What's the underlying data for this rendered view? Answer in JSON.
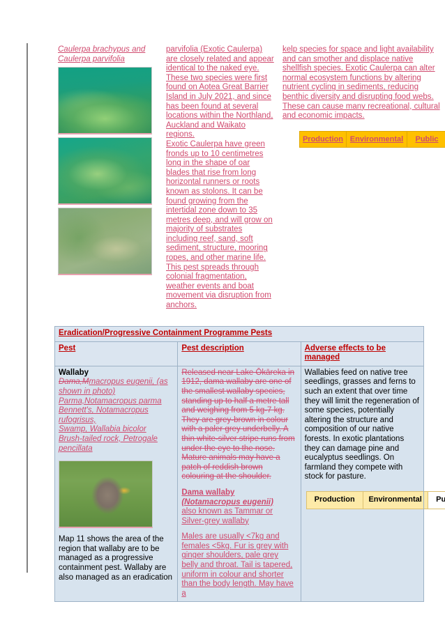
{
  "document": {
    "change_bar": true
  },
  "caulerpa_section": {
    "species_heading": "Caulerpa brachypus and Caulerpa parvifolia",
    "photos": [
      {
        "name": "caulerpa-photo-1",
        "alt": "Dense green Caulerpa mound on seafloor"
      },
      {
        "name": "caulerpa-photo-2",
        "alt": "Caulerpa fronds covering seabed"
      },
      {
        "name": "caulerpa-photo-3",
        "alt": "Caulerpa spreading over sandy sediment"
      }
    ],
    "description_paragraphs": [
      "parvifolia (Exotic Caulerpa) are closely related and appear identical to the naked eye. These two species were first found on Aotea Great Barrier Island in July 2021, and since has been found at several locations within the Northland, Auckland and Waikato regions.",
      "Exotic Caulerpa have green fronds up to 10 centimetres long in the shape of oar blades that rise from long horizontal runners or roots known as stolons. It can be found growing from the intertidal zone down to 35 metres deep, and will grow on majority of substrates including reef, sand, soft sediment, structure, mooring ropes, and other marine life. This pest spreads through colonial fragmentation, weather events and boat movement via disruption from anchors."
    ],
    "effects_paragraphs": [
      "kelp species for space and light availability and can smother and displace native shellfish species. Exotic Caulerpa can alter normal ecosystem functions by altering nutrient cycling in sediments, reducing benthic diversity and disrupting food webs. These can cause many recreational, cultural and economic impacts."
    ],
    "badges": [
      {
        "label": "Production",
        "state": "on"
      },
      {
        "label": "Environmental",
        "state": "on"
      },
      {
        "label": "Public",
        "state": "on"
      }
    ]
  },
  "pest_section": {
    "table_title": "Eradication/Progressive Containment Programme Pests",
    "columns": [
      "Pest",
      "Pest description",
      "Adverse effects to be managed"
    ],
    "row": {
      "pest_name": "Wallaby",
      "pest_species": [
        {
          "struck": "Dama,M",
          "inserted": "m",
          "rest": "acropus eugenii, (as shown in photo)"
        },
        {
          "text": "Parma,Notamacropus parma"
        },
        {
          "text": "Bennett's, Notamacropus rufogrisus,"
        },
        {
          "text": "Swamp, Wallabia bicolor"
        },
        {
          "text": "Brush-tailed rock, Petrogale pencillata"
        }
      ],
      "pest_photo": {
        "name": "wallaby-photo",
        "alt": "Dama wallaby on grass eating fruit"
      },
      "pest_map_note": "Map 11 shows the area of the region that wallaby are to be managed as a progressive containment pest. Wallaby are also managed as an eradication",
      "description_deleted": "Released near Lake Ōkāreka in 1912, dama wallaby are one of the smallest wallaby species, standing up to half a metre tall and weighing from 5 kg-7 kg. They are grey-brown in colour with a paler grey underbelly. A thin white-silver stripe runs from under the eye to the nose. Mature animals may have a patch of reddish brown colouring at the shoulder.",
      "description_inserted_heading_line1": "Dama wallaby",
      "description_inserted_heading_line2": "(Notamacropus eugenii)",
      "description_inserted_heading_line3": "also known as Tammar or Silver-grey wallaby",
      "description_inserted_body": "Males are usually <7kg and females <5kg. Fur is grey with ginger shoulders, pale grey belly and throat. Tail is tapered, uniform in colour and shorter than the body length. May have a",
      "adverse_effects": "Wallabies feed on native tree seedlings, grasses and ferns to such an extent that over time they will limit the regeneration of some species, potentially altering the structure and composition of our native forests. In exotic plantations they can damage pine and eucalyptus seedlings. On farmland they compete with stock for pasture.",
      "badges": [
        {
          "label": "Production",
          "state": "on"
        },
        {
          "label": "Environmental",
          "state": "on"
        },
        {
          "label": "Public",
          "state": "off"
        }
      ]
    }
  },
  "colors": {
    "tracked_change": "#d04a6e",
    "header_red": "#c00000",
    "badge_gold": "#ffc000",
    "badge_yellow": "#fdeaa8",
    "table_blue": "#d7e3ee",
    "header_blue": "#dbe5f0"
  }
}
